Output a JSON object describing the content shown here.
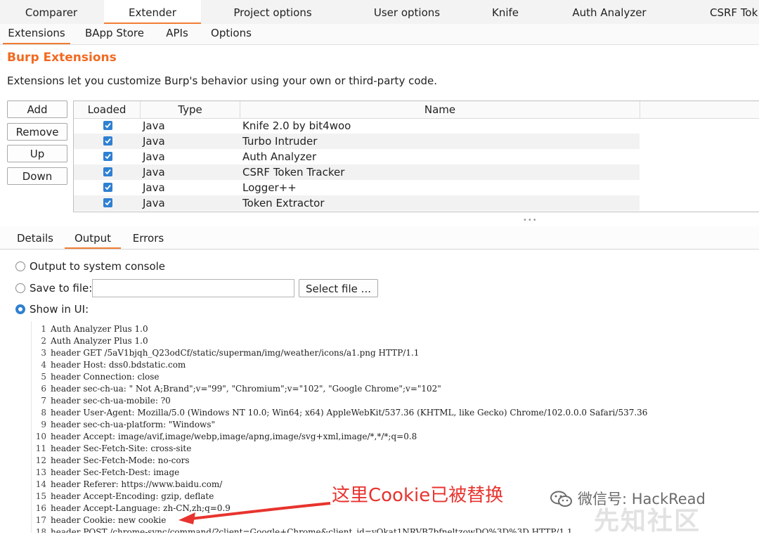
{
  "top_tabs": [
    "Comparer",
    "Extender",
    "Project options",
    "User options",
    "Knife",
    "Auth Analyzer",
    "CSRF Tok"
  ],
  "sub_tabs": [
    "Extensions",
    "BApp Store",
    "APIs",
    "Options"
  ],
  "extensions": {
    "title": "Burp Extensions",
    "description": "Extensions let you customize Burp's behavior using your own or third-party code.",
    "buttons": {
      "add": "Add",
      "remove": "Remove",
      "up": "Up",
      "down": "Down"
    },
    "columns": [
      "Loaded",
      "Type",
      "Name"
    ],
    "rows": [
      {
        "loaded": true,
        "type": "Java",
        "name": "Knife 2.0 by bit4woo"
      },
      {
        "loaded": true,
        "type": "Java",
        "name": "Turbo Intruder"
      },
      {
        "loaded": true,
        "type": "Java",
        "name": "Auth Analyzer"
      },
      {
        "loaded": true,
        "type": "Java",
        "name": "CSRF Token Tracker"
      },
      {
        "loaded": true,
        "type": "Java",
        "name": "Logger++"
      },
      {
        "loaded": true,
        "type": "Java",
        "name": "Token Extractor"
      }
    ]
  },
  "output_tabs": [
    "Details",
    "Output",
    "Errors"
  ],
  "output_options": {
    "system_console": "Output to system console",
    "save_to_file": "Save to file:",
    "save_file_value": "",
    "select_file": "Select file ...",
    "show_in_ui": "Show in UI:",
    "selected": "show_in_ui"
  },
  "console_lines": [
    "Auth Analyzer Plus 1.0",
    "Auth Analyzer Plus 1.0",
    "header GET /5aV1bjqh_Q23odCf/static/superman/img/weather/icons/a1.png HTTP/1.1",
    "header Host: dss0.bdstatic.com",
    "header Connection: close",
    "header sec-ch-ua: \" Not A;Brand\";v=\"99\", \"Chromium\";v=\"102\", \"Google Chrome\";v=\"102\"",
    "header sec-ch-ua-mobile: ?0",
    "header User-Agent: Mozilla/5.0 (Windows NT 10.0; Win64; x64) AppleWebKit/537.36 (KHTML, like Gecko) Chrome/102.0.0.0 Safari/537.36",
    "header sec-ch-ua-platform: \"Windows\"",
    "header Accept: image/avif,image/webp,image/apng,image/svg+xml,image/*,*/*;q=0.8",
    "header Sec-Fetch-Site: cross-site",
    "header Sec-Fetch-Mode: no-cors",
    "header Sec-Fetch-Dest: image",
    "header Referer: https://www.baidu.com/",
    "header Accept-Encoding: gzip, deflate",
    "header Accept-Language: zh-CN,zh;q=0.9",
    "header Cookie: new cookie",
    "header POST /chrome-sync/command/?client=Google+Chrome&client_id=yQkat1NRVB7bfneltzowDQ%3D%3D HTTP/1.1"
  ],
  "annotation": "这里Cookie已被替换",
  "watermark": "微信号: HackRead",
  "watermark2": "先知社区",
  "colors": {
    "accent": "#f17d33",
    "title": "#f06a22",
    "checkbox": "#2f80d1",
    "annotation": "#e8332e"
  }
}
